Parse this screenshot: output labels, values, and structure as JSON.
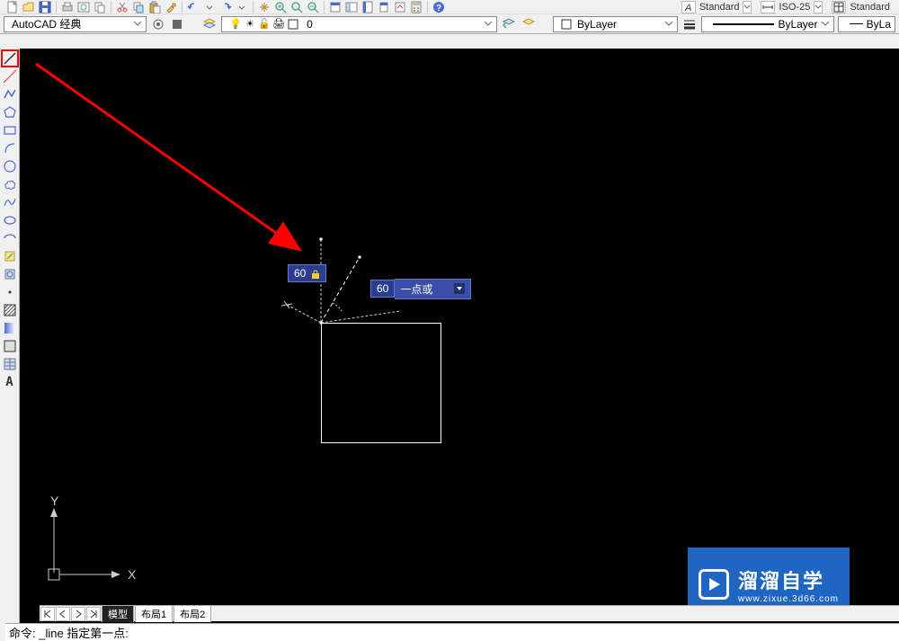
{
  "top_std": {
    "text_style": "Standard",
    "dim_style": "ISO-25",
    "table_style": "Standard"
  },
  "row3": {
    "workspace": "AutoCAD 经典",
    "layer0": "0",
    "bylayer": "ByLayer",
    "bylayer2": "ByLayer",
    "bylayer3": "ByLa"
  },
  "drawing": {
    "angle_value": "60",
    "input_value": "60",
    "prompt_suffix": "一点或"
  },
  "ucs": {
    "x": "X",
    "y": "Y"
  },
  "tabs": {
    "model": "模型",
    "layout1": "布局1",
    "layout2": "布局2"
  },
  "cmd": "命令: _line 指定第一点:",
  "watermark": {
    "cn": "溜溜自学",
    "url": "www.zixue.3d66.com"
  }
}
